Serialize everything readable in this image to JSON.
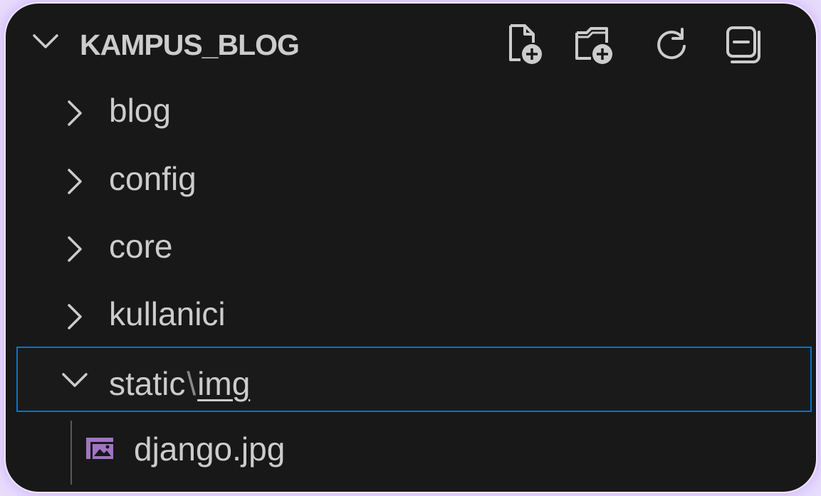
{
  "explorer": {
    "title": "KAMPUS_BLOG",
    "actions": [
      {
        "name": "new-file",
        "icon": "new-file-icon"
      },
      {
        "name": "new-folder",
        "icon": "new-folder-icon"
      },
      {
        "name": "refresh",
        "icon": "refresh-icon"
      },
      {
        "name": "collapse-all",
        "icon": "collapse-all-icon"
      }
    ],
    "folders": [
      {
        "label": "blog",
        "expanded": false
      },
      {
        "label": "config",
        "expanded": false
      },
      {
        "label": "core",
        "expanded": false
      },
      {
        "label": "kullanici",
        "expanded": false
      }
    ],
    "selected_folder": {
      "part1": "static",
      "separator": "\\",
      "part2": "img",
      "expanded": true
    },
    "file": {
      "label": "django.jpg",
      "icon": "image-file-icon"
    }
  },
  "colors": {
    "panel_bg": "#181818",
    "text": "#cccccc",
    "selection_border": "#0a74c4",
    "image_icon": "#a074c4",
    "page_bg": "#e6dcfb"
  }
}
